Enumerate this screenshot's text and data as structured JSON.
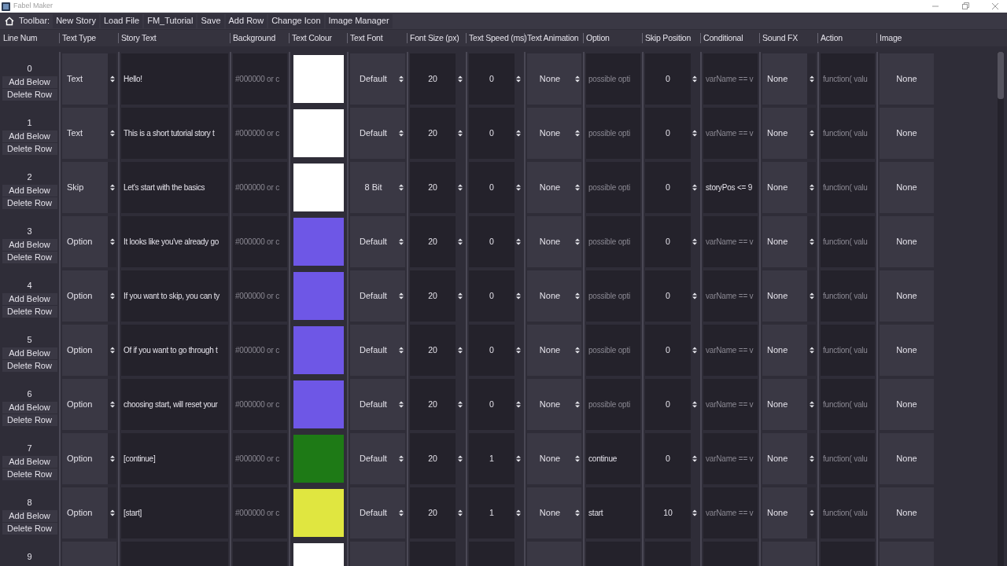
{
  "window": {
    "title": "Fabel Maker"
  },
  "toolbar": {
    "label": "Toolbar:",
    "items": [
      "New Story",
      "Load File",
      "FM_Tutorial",
      "Save",
      "Add Row",
      "Change Icon",
      "Image Manager"
    ]
  },
  "columns": [
    "Line Num",
    "Text Type",
    "Story Text",
    "Background",
    "Text Colour",
    "Text Font",
    "Font Size (px)",
    "Text Speed (ms)",
    "Text Animation",
    "Option",
    "Skip Position",
    "Conditional",
    "Sound FX",
    "Action",
    "Image"
  ],
  "rows": [
    {
      "line_num": "0",
      "buttons": [
        "Add Below",
        "Delete Row"
      ],
      "text_type": "Text",
      "story_text": "Hello!",
      "background": {
        "placeholder": "#000000 or c"
      },
      "color": "#ffffff",
      "font": "Default",
      "font_size": "20",
      "speed": "0",
      "animation": "None",
      "option": {
        "placeholder": "possible opti"
      },
      "skip": "0",
      "conditional": {
        "placeholder": "varName == v"
      },
      "sound": "None",
      "action": {
        "placeholder": "function( valu"
      },
      "image": "None"
    },
    {
      "line_num": "1",
      "buttons": [
        "Add Below",
        "Delete Row"
      ],
      "text_type": "Text",
      "story_text": "This is a short tutorial story t",
      "background": {
        "placeholder": "#000000 or c"
      },
      "color": "#ffffff",
      "font": "Default",
      "font_size": "20",
      "speed": "0",
      "animation": "None",
      "option": {
        "placeholder": "possible opti"
      },
      "skip": "0",
      "conditional": {
        "placeholder": "varName == v"
      },
      "sound": "None",
      "action": {
        "placeholder": "function( valu"
      },
      "image": "None"
    },
    {
      "line_num": "2",
      "buttons": [
        "Add Below",
        "Delete Row"
      ],
      "text_type": "Skip",
      "story_text": "Let's start with the basics",
      "background": {
        "placeholder": "#000000 or c"
      },
      "color": "#ffffff",
      "font": "8 Bit",
      "font_size": "20",
      "speed": "0",
      "animation": "None",
      "option": {
        "placeholder": "possible opti"
      },
      "skip": "0",
      "conditional": {
        "value": "storyPos <= 9"
      },
      "sound": "None",
      "action": {
        "placeholder": "function( valu"
      },
      "image": "None"
    },
    {
      "line_num": "3",
      "buttons": [
        "Add Below",
        "Delete Row"
      ],
      "text_type": "Option",
      "story_text": "It looks like you've already go",
      "background": {
        "placeholder": "#000000 or c"
      },
      "color": "#6e57e6",
      "font": "Default",
      "font_size": "20",
      "speed": "0",
      "animation": "None",
      "option": {
        "placeholder": "possible opti"
      },
      "skip": "0",
      "conditional": {
        "placeholder": "varName == v"
      },
      "sound": "None",
      "action": {
        "placeholder": "function( valu"
      },
      "image": "None"
    },
    {
      "line_num": "4",
      "buttons": [
        "Add Below",
        "Delete Row"
      ],
      "text_type": "Option",
      "story_text": "If you want to skip, you can ty",
      "background": {
        "placeholder": "#000000 or c"
      },
      "color": "#6e57e6",
      "font": "Default",
      "font_size": "20",
      "speed": "0",
      "animation": "None",
      "option": {
        "placeholder": "possible opti"
      },
      "skip": "0",
      "conditional": {
        "placeholder": "varName == v"
      },
      "sound": "None",
      "action": {
        "placeholder": "function( valu"
      },
      "image": "None"
    },
    {
      "line_num": "5",
      "buttons": [
        "Add Below",
        "Delete Row"
      ],
      "text_type": "Option",
      "story_text": "Of if you want to go through t",
      "background": {
        "placeholder": "#000000 or c"
      },
      "color": "#6e57e6",
      "font": "Default",
      "font_size": "20",
      "speed": "0",
      "animation": "None",
      "option": {
        "placeholder": "possible opti"
      },
      "skip": "0",
      "conditional": {
        "placeholder": "varName == v"
      },
      "sound": "None",
      "action": {
        "placeholder": "function( valu"
      },
      "image": "None"
    },
    {
      "line_num": "6",
      "buttons": [
        "Add Below",
        "Delete Row"
      ],
      "text_type": "Option",
      "story_text": "choosing start, will reset your",
      "background": {
        "placeholder": "#000000 or c"
      },
      "color": "#6e57e6",
      "font": "Default",
      "font_size": "20",
      "speed": "0",
      "animation": "None",
      "option": {
        "placeholder": "possible opti"
      },
      "skip": "0",
      "conditional": {
        "placeholder": "varName == v"
      },
      "sound": "None",
      "action": {
        "placeholder": "function( valu"
      },
      "image": "None"
    },
    {
      "line_num": "7",
      "buttons": [
        "Add Below",
        "Delete Row"
      ],
      "text_type": "Option",
      "story_text": "[continue]",
      "background": {
        "placeholder": "#000000 or c"
      },
      "color": "#1e7a16",
      "font": "Default",
      "font_size": "20",
      "speed": "1",
      "animation": "None",
      "option": {
        "value": "continue"
      },
      "skip": "0",
      "conditional": {
        "placeholder": "varName == v"
      },
      "sound": "None",
      "action": {
        "placeholder": "function( valu"
      },
      "image": "None"
    },
    {
      "line_num": "8",
      "buttons": [
        "Add Below",
        "Delete Row"
      ],
      "text_type": "Option",
      "story_text": "[start]",
      "background": {
        "placeholder": "#000000 or c"
      },
      "color": "#e0e640",
      "font": "Default",
      "font_size": "20",
      "speed": "1",
      "animation": "None",
      "option": {
        "value": "start"
      },
      "skip": "10",
      "conditional": {
        "placeholder": "varName == v"
      },
      "sound": "None",
      "action": {
        "placeholder": "function( valu"
      },
      "image": "None"
    },
    {
      "line_num": "9",
      "color": "#ffffff"
    }
  ]
}
